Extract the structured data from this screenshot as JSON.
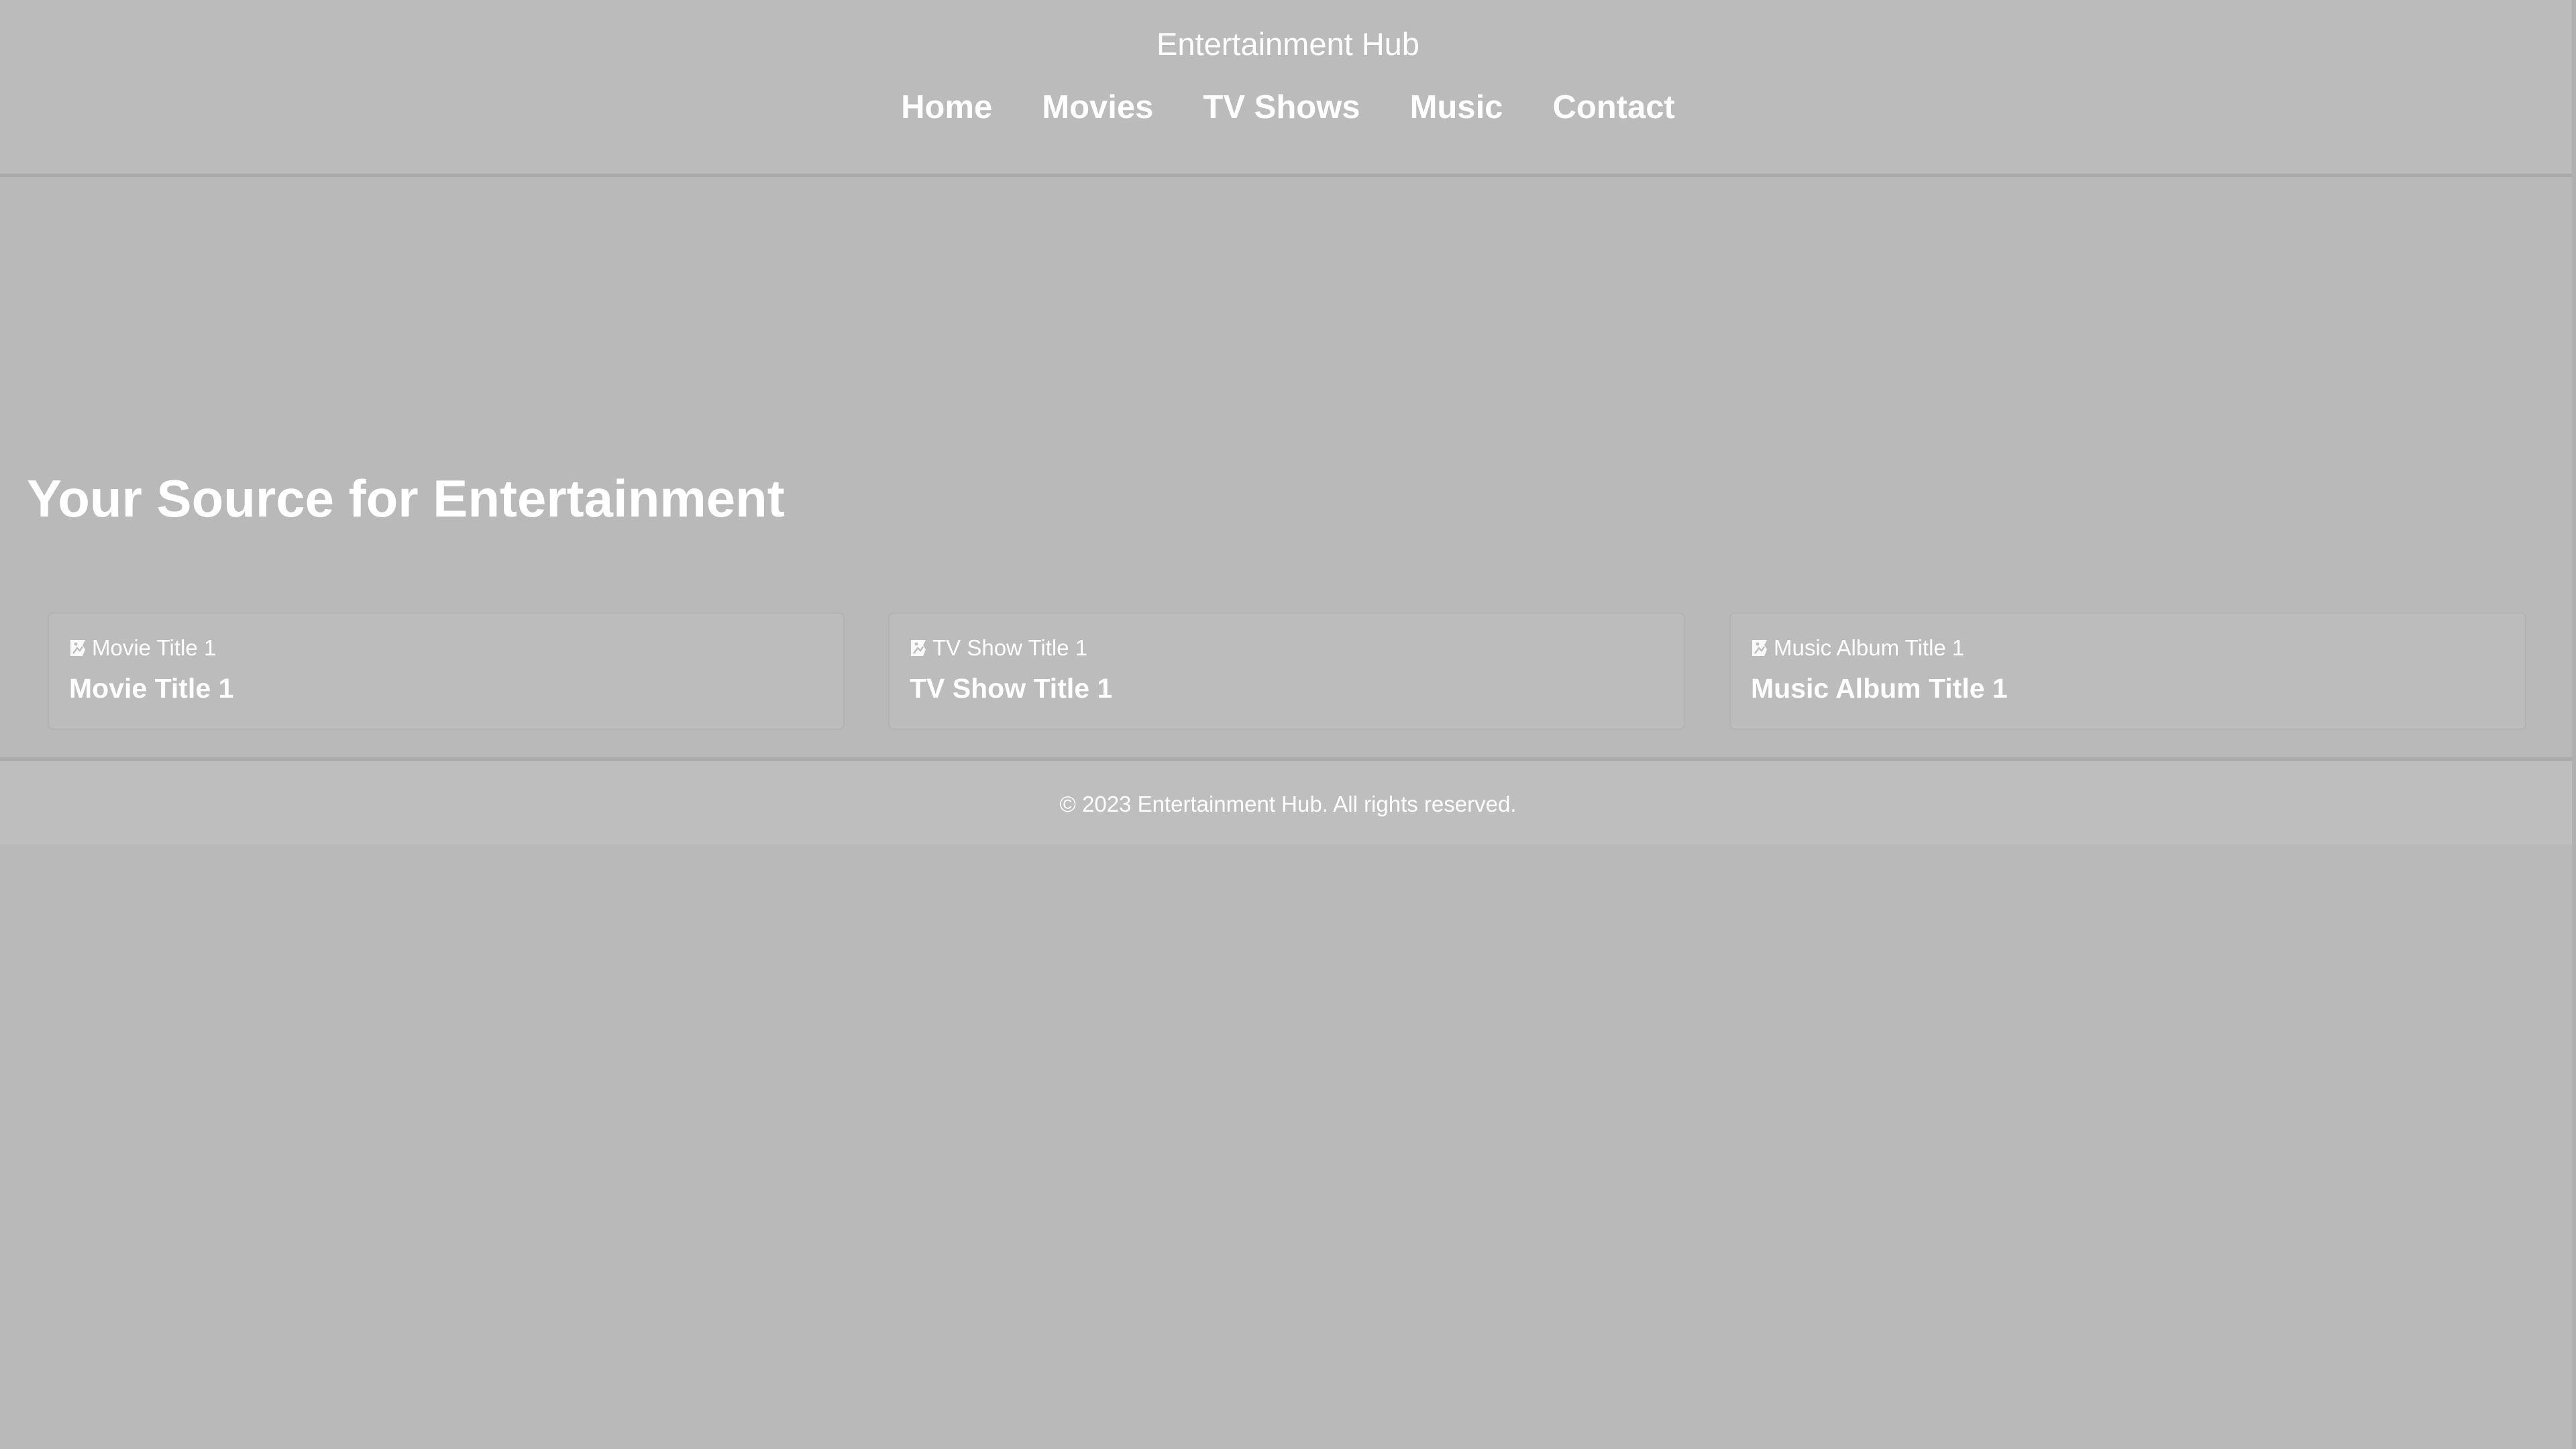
{
  "header": {
    "site_title": "Entertainment Hub",
    "nav": [
      {
        "label": "Home"
      },
      {
        "label": "Movies"
      },
      {
        "label": "TV Shows"
      },
      {
        "label": "Music"
      },
      {
        "label": "Contact"
      }
    ]
  },
  "hero": {
    "title": "Your Source for Entertainment"
  },
  "cards": [
    {
      "image_alt": "Movie Title 1",
      "title": "Movie Title 1",
      "icon": "broken-image-icon"
    },
    {
      "image_alt": "TV Show Title 1",
      "title": "TV Show Title 1",
      "icon": "broken-image-icon"
    },
    {
      "image_alt": "Music Album Title 1",
      "title": "Music Album Title 1",
      "icon": "broken-image-icon"
    }
  ],
  "footer": {
    "copyright": "© 2023 Entertainment Hub. All rights reserved."
  },
  "colors": {
    "background": "#b9b9b9",
    "text": "#ffffff",
    "border": "#a9a9a9"
  }
}
